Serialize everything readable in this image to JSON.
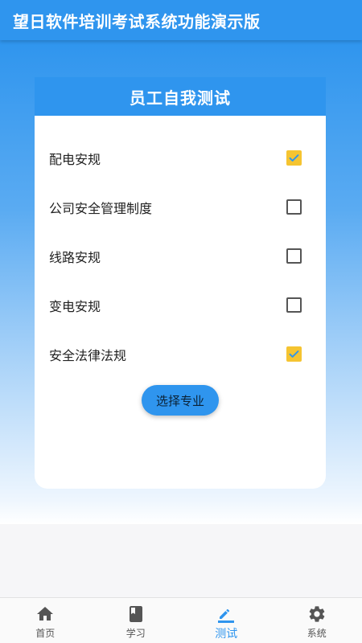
{
  "header": {
    "title": "望日软件培训考试系统功能演示版"
  },
  "card": {
    "title": "员工自我测试",
    "options": [
      {
        "label": "配电安规",
        "checked": true
      },
      {
        "label": "公司安全管理制度",
        "checked": false
      },
      {
        "label": "线路安规",
        "checked": false
      },
      {
        "label": "变电安规",
        "checked": false
      },
      {
        "label": "安全法律法规",
        "checked": true
      }
    ],
    "button_label": "选择专业"
  },
  "nav": {
    "items": [
      {
        "label": "首页",
        "icon": "home-icon",
        "active": false
      },
      {
        "label": "学习",
        "icon": "book-icon",
        "active": false
      },
      {
        "label": "测试",
        "icon": "pencil-icon",
        "active": true
      },
      {
        "label": "系统",
        "icon": "gear-icon",
        "active": false
      }
    ]
  },
  "colors": {
    "primary": "#2f95ee",
    "check": "#f5c431",
    "inactive_icon": "#555555"
  }
}
